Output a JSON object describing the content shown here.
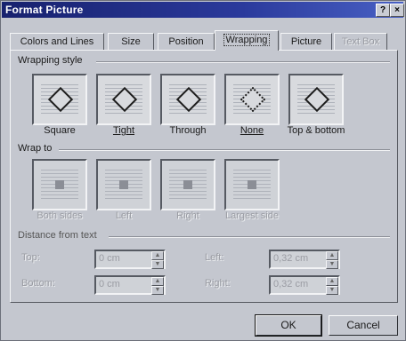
{
  "window": {
    "title": "Format Picture",
    "help_button": "?",
    "close_button": "×"
  },
  "tabs": [
    {
      "label": "Colors and Lines"
    },
    {
      "label": "Size"
    },
    {
      "label": "Position"
    },
    {
      "label": "Wrapping",
      "active": true
    },
    {
      "label": "Picture"
    },
    {
      "label": "Text Box",
      "disabled": true
    }
  ],
  "wrapping_style": {
    "heading": "Wrapping style",
    "options": [
      {
        "label": "Square",
        "icon": "square-wrap-icon"
      },
      {
        "label": "Tight",
        "icon": "tight-wrap-icon"
      },
      {
        "label": "Through",
        "icon": "through-wrap-icon"
      },
      {
        "label": "None",
        "icon": "no-wrap-icon"
      },
      {
        "label": "Top & bottom",
        "icon": "top-bottom-wrap-icon"
      }
    ]
  },
  "wrap_to": {
    "heading": "Wrap to",
    "options": [
      {
        "label": "Both sides",
        "icon": "both-sides-icon"
      },
      {
        "label": "Left",
        "icon": "left-side-icon"
      },
      {
        "label": "Right",
        "icon": "right-side-icon"
      },
      {
        "label": "Largest side",
        "icon": "largest-side-icon"
      }
    ]
  },
  "distance": {
    "heading": "Distance from text",
    "top": {
      "label": "Top:",
      "value": "0 cm"
    },
    "bottom": {
      "label": "Bottom:",
      "value": "0 cm"
    },
    "left": {
      "label": "Left:",
      "value": "0,32 cm"
    },
    "right": {
      "label": "Right:",
      "value": "0,32 cm"
    }
  },
  "buttons": {
    "ok": "OK",
    "cancel": "Cancel"
  },
  "colors": {
    "titlebar": "#17216e",
    "face": "#c4c7cf",
    "disabled_text": "#9a9ca3"
  }
}
